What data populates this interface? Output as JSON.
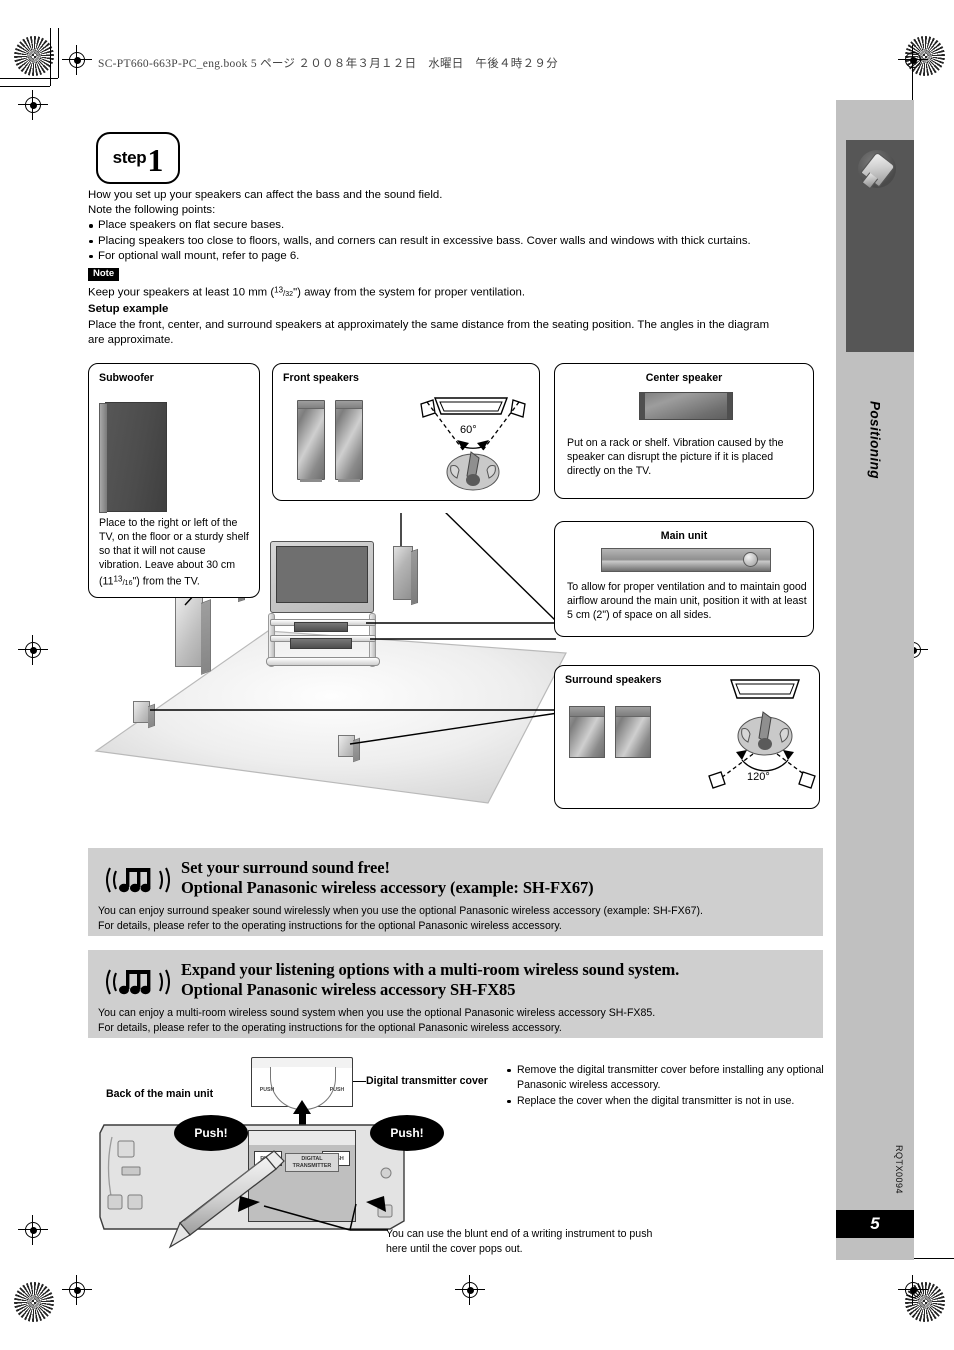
{
  "header": {
    "book_line": "SC-PT660-663P-PC_eng.book  5 ページ  ２００８年３月１２日　水曜日　午後４時２９分"
  },
  "side": {
    "tab_label": "Positioning",
    "doc_code": "RQTX0094",
    "page_number": "5",
    "icon": "plug-icon"
  },
  "step": {
    "word": "step",
    "number": "1"
  },
  "intro": {
    "line1": "How you set up your speakers can affect the bass and the sound field.",
    "line2": "Note the following points:",
    "bullets": [
      "Place speakers on flat secure bases.",
      "Placing speakers too close to floors, walls, and corners can result in excessive bass. Cover walls and windows with thick curtains.",
      "For optional wall mount, refer to page 6."
    ],
    "note_badge": "Note",
    "note_text_a": "Keep your speakers at least 10 mm (",
    "note_frac_num": "13",
    "note_frac_den": "32",
    "note_text_b": "\") away from the system for proper ventilation.",
    "setup_heading": "Setup example",
    "setup_text": "Place the front, center, and surround speakers at approximately the same distance from the seating position. The angles in the diagram are approximate."
  },
  "callouts": {
    "subwoofer": {
      "title": "Subwoofer",
      "text_a": "Place to the right or left of the TV, on the floor or a sturdy shelf so that it will not cause vibration. Leave about 30 cm (11",
      "frac_num": "13",
      "frac_den": "16",
      "text_b": "\") from the TV."
    },
    "front_speakers": {
      "title": "Front speakers",
      "angle": "60°"
    },
    "center_speaker": {
      "title": "Center speaker",
      "text": "Put on a rack or shelf. Vibration caused by the speaker can disrupt the picture if it is placed directly on the TV."
    },
    "main_unit": {
      "title": "Main unit",
      "text": "To allow for proper ventilation and to maintain good airflow around the main unit, position it with at least 5 cm (2\") of space on all sides."
    },
    "surround_speakers": {
      "title": "Surround speakers",
      "angle": "120°"
    }
  },
  "promos": [
    {
      "icon": "music-note-wireless-icon",
      "heading_line1": "Set your surround sound free!",
      "heading_line2": "Optional Panasonic wireless accessory (example: SH-FX67)",
      "body_line1": "You can enjoy surround speaker sound wirelessly when you use the optional Panasonic wireless accessory (example: SH-FX67).",
      "body_line2": "For details, please refer to the operating instructions for the optional Panasonic wireless accessory."
    },
    {
      "icon": "music-note-wireless-icon",
      "heading_line1": "Expand your listening options with a multi-room wireless sound system.",
      "heading_line2": "Optional Panasonic wireless accessory SH-FX85",
      "body_line1": "You can enjoy a multi-room wireless sound system when you use the optional Panasonic wireless accessory SH-FX85.",
      "body_line2": "For details, please refer to the operating instructions for the optional Panasonic wireless accessory."
    }
  ],
  "bottom": {
    "back_label": "Back of the main unit",
    "cover_label": "Digital transmitter cover",
    "push_left": "Push!",
    "push_right": "Push!",
    "push_btn_label": "PUSH",
    "cover_push_left": "PUSH",
    "cover_push_right": "PUSH",
    "dt_label_line1": "DIGITAL",
    "dt_label_line2": "TRANSMITTER",
    "bullets": [
      "Remove the digital transmitter cover before installing any optional Panasonic wireless accessory.",
      "Replace the cover when the digital transmitter is not in use."
    ],
    "blunt_text_line1": "You can use the blunt end of a writing instrument to push",
    "blunt_text_line2": "here until the cover pops out."
  },
  "colors": {
    "promo_bg": "#cfcfcf",
    "side_col": "#c0c0c0",
    "side_tab": "#565656",
    "black": "#000000"
  }
}
